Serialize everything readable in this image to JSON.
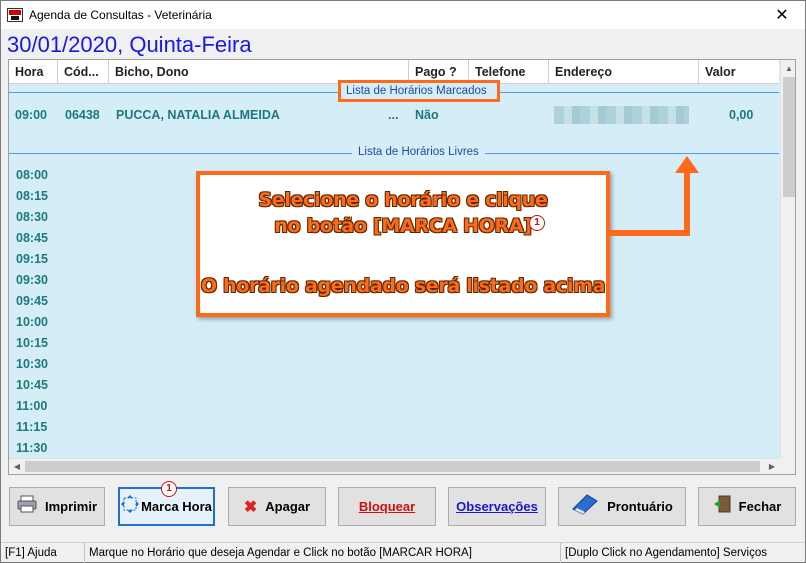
{
  "window": {
    "title": "Agenda de Consultas - Veterinária",
    "close_symbol": "✕"
  },
  "date_label": "30/01/2020, Quinta-Feira",
  "grid": {
    "columns": [
      "Hora",
      "Cód...",
      "Bicho, Dono",
      "Pago ?",
      "Telefone",
      "Endereço",
      "Valor"
    ],
    "section_booked": "Lista de Horários Marcados",
    "section_free": "Lista de Horários Livres",
    "booked_rows": [
      {
        "hora": "09:00",
        "codigo": "06438",
        "bicho_dono": "PUCCA, NATALIA ALMEIDA",
        "ellipsis": "...",
        "pago": "Não",
        "valor": "0,00"
      }
    ],
    "free_times": [
      "08:00",
      "08:15",
      "08:30",
      "08:45",
      "09:15",
      "09:30",
      "09:45",
      "10:00",
      "10:15",
      "10:30",
      "10:45",
      "11:00",
      "11:15",
      "11:30"
    ]
  },
  "callout": {
    "line1": "Selecione o horário e clique",
    "line2": "no botão [MARCA HORA]",
    "line3": "O horário agendado será listado acima",
    "badge": "1",
    "color": "#ff6a1a"
  },
  "buttons": {
    "imprimir": "Imprimir",
    "marca_hora": "Marca Hora",
    "marca_badge": "1",
    "apagar": "Apagar",
    "bloquear": "Bloquear",
    "observacoes": "Observações",
    "prontuario": "Prontuário",
    "fechar": "Fechar"
  },
  "statusbar": {
    "help": "[F1] Ajuda",
    "hint": "Marque no Horário que deseja Agendar e Click no botão [MARCAR HORA]",
    "double_click": "[Duplo Click no Agendamento] Serviços"
  },
  "colors": {
    "date": "#1818e8",
    "grid_background": "#d5edf7",
    "row_text": "#1c7a7a",
    "accent_orange": "#ff6a1a"
  },
  "icons": {
    "app": "app-logo-icon",
    "close": "close-icon",
    "imprimir": "printer-icon",
    "marca_hora": "move-arrows-icon",
    "apagar": "delete-x-icon",
    "prontuario": "book-icon",
    "fechar": "exit-door-icon"
  }
}
